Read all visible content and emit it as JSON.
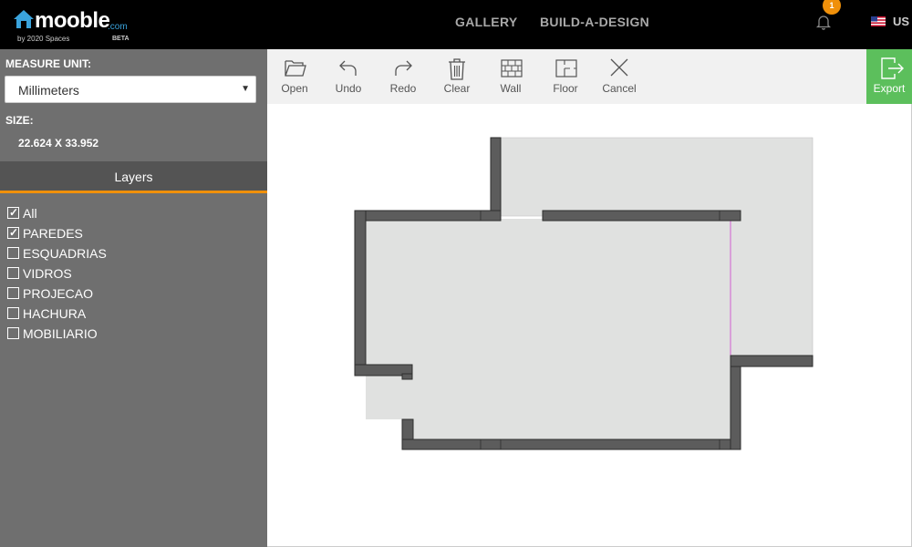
{
  "header": {
    "logo": {
      "word": "mooble",
      "suffix": ".com",
      "tagline": "by 2020 Spaces",
      "beta": "BETA"
    },
    "nav": {
      "gallery": "GALLERY",
      "build": "BUILD-A-DESIGN"
    },
    "notifications": {
      "count": "1"
    },
    "language": {
      "code": "US"
    }
  },
  "sidebar": {
    "measure_label": "MEASURE UNIT:",
    "measure_value": "Millimeters",
    "size_label": "SIZE:",
    "size_value": "22.624 X 33.952",
    "layers_title": "Layers",
    "layers": [
      {
        "label": "All",
        "checked": true
      },
      {
        "label": "PAREDES",
        "checked": true
      },
      {
        "label": "ESQUADRIAS",
        "checked": false
      },
      {
        "label": "VIDROS",
        "checked": false
      },
      {
        "label": "PROJECAO",
        "checked": false
      },
      {
        "label": "HACHURA",
        "checked": false
      },
      {
        "label": "MOBILIARIO",
        "checked": false
      }
    ]
  },
  "toolbar": {
    "open": "Open",
    "undo": "Undo",
    "redo": "Redo",
    "clear": "Clear",
    "wall": "Wall",
    "floor": "Floor",
    "cancel": "Cancel",
    "export": "Export"
  },
  "colors": {
    "accent": "#f0900a",
    "export": "#5cbf5c",
    "wall": "#5a5a5a",
    "floor": "#e0e1e0"
  }
}
